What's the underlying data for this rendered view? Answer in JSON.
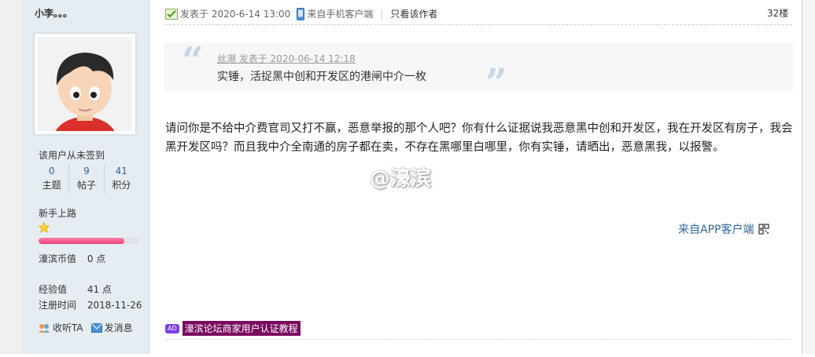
{
  "user": {
    "name": "小李。。。",
    "signin_status": "该用户从未签到",
    "stats": [
      {
        "num": "0",
        "label": "主题"
      },
      {
        "num": "9",
        "label": "帖子"
      },
      {
        "num": "41",
        "label": "积分"
      }
    ],
    "rank": "新手上路",
    "progress": 0.85,
    "coins": {
      "key": "濠滨币值",
      "value": "0 点"
    },
    "exp": {
      "key": "经验值",
      "value": "41 点"
    },
    "registered": {
      "key": "注册时间",
      "value": "2018-11-26"
    },
    "actions": {
      "listen": "收听TA",
      "message": "发消息"
    }
  },
  "post": {
    "posted_at": "发表于 2020-6-14 13:00",
    "source": "来自手机客户端",
    "only_author": "只看该作者",
    "floor": "32楼",
    "quote": {
      "meta": "丝潮 发表于 2020-06-14 12:18",
      "text": "实锤，活捉黑中创和开发区的港闸中介一枚"
    },
    "body": "请问你是不给中介费官司又打不赢，恶意举报的那个人吧？你有什么证据说我恶意黑中创和开发区，我在开发区有房子，我会黑开发区吗？而且我中介全南通的房子都在卖，不存在黑哪里白哪里，你有实锤，请晒出，恶意黑我，以报警。",
    "watermark": "@濠滨",
    "app_source": "来自APP客户端",
    "ad_badge": "AD",
    "ad_text": "濠滨论坛商家用户认证教程"
  },
  "colors": {
    "link": "#336699",
    "sidebar": "#e5edf2",
    "ad_bg": "#7a0a5e"
  }
}
